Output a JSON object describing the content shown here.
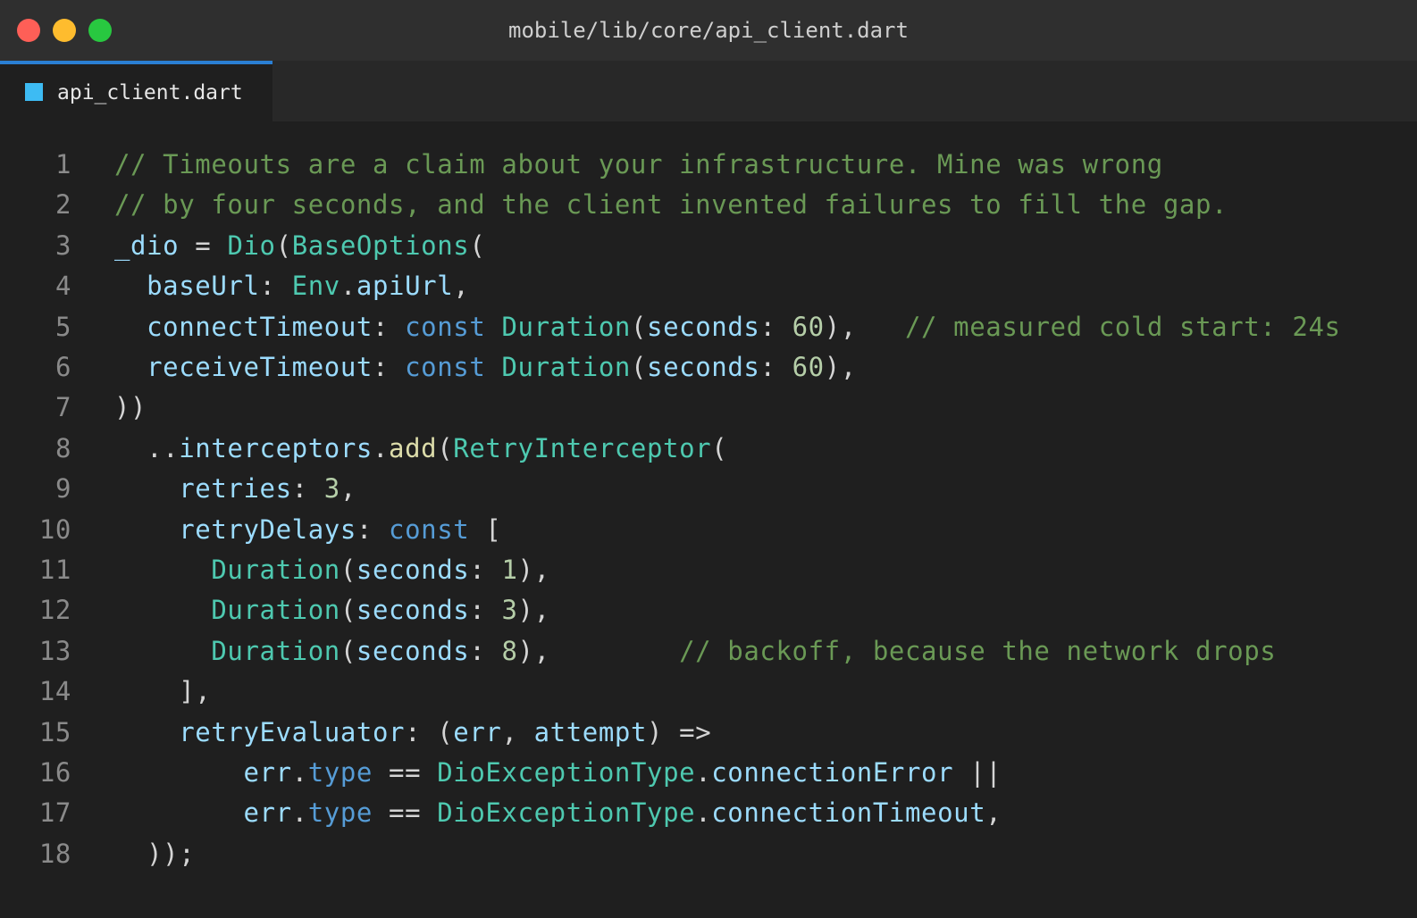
{
  "window": {
    "title": "mobile/lib/core/api_client.dart"
  },
  "tab": {
    "label": "api_client.dart",
    "icon": "dart-file-icon"
  },
  "colors": {
    "comment": "#6a9955",
    "type": "#4ec9b0",
    "property": "#9cdcfe",
    "keyword": "#569cd6",
    "number": "#b5cea8",
    "function": "#dcdcaa",
    "accent": "#2a7fd4"
  },
  "lines": [
    {
      "n": "1",
      "tokens": [
        {
          "t": "// Timeouts are a claim about your infrastructure. Mine was wrong",
          "k": "comment"
        }
      ]
    },
    {
      "n": "2",
      "tokens": [
        {
          "t": "// by four seconds, and the client invented failures to fill the gap.",
          "k": "comment"
        }
      ]
    },
    {
      "n": "3",
      "tokens": [
        {
          "t": "_dio",
          "k": "prop"
        },
        {
          "t": " = ",
          "k": "punc"
        },
        {
          "t": "Dio",
          "k": "type"
        },
        {
          "t": "(",
          "k": "punc"
        },
        {
          "t": "BaseOptions",
          "k": "type"
        },
        {
          "t": "(",
          "k": "punc"
        }
      ]
    },
    {
      "n": "4",
      "tokens": [
        {
          "t": "  ",
          "k": "punc"
        },
        {
          "t": "baseUrl",
          "k": "prop"
        },
        {
          "t": ": ",
          "k": "punc"
        },
        {
          "t": "Env",
          "k": "type"
        },
        {
          "t": ".",
          "k": "punc"
        },
        {
          "t": "apiUrl",
          "k": "prop"
        },
        {
          "t": ",",
          "k": "punc"
        }
      ]
    },
    {
      "n": "5",
      "tokens": [
        {
          "t": "  ",
          "k": "punc"
        },
        {
          "t": "connectTimeout",
          "k": "prop"
        },
        {
          "t": ": ",
          "k": "punc"
        },
        {
          "t": "const",
          "k": "kw"
        },
        {
          "t": " ",
          "k": "punc"
        },
        {
          "t": "Duration",
          "k": "type"
        },
        {
          "t": "(",
          "k": "punc"
        },
        {
          "t": "seconds",
          "k": "prop"
        },
        {
          "t": ": ",
          "k": "punc"
        },
        {
          "t": "60",
          "k": "num"
        },
        {
          "t": "),   ",
          "k": "punc"
        },
        {
          "t": "// measured cold start: 24s",
          "k": "comment"
        }
      ]
    },
    {
      "n": "6",
      "tokens": [
        {
          "t": "  ",
          "k": "punc"
        },
        {
          "t": "receiveTimeout",
          "k": "prop"
        },
        {
          "t": ": ",
          "k": "punc"
        },
        {
          "t": "const",
          "k": "kw"
        },
        {
          "t": " ",
          "k": "punc"
        },
        {
          "t": "Duration",
          "k": "type"
        },
        {
          "t": "(",
          "k": "punc"
        },
        {
          "t": "seconds",
          "k": "prop"
        },
        {
          "t": ": ",
          "k": "punc"
        },
        {
          "t": "60",
          "k": "num"
        },
        {
          "t": "),",
          "k": "punc"
        }
      ]
    },
    {
      "n": "7",
      "tokens": [
        {
          "t": "))",
          "k": "punc"
        }
      ]
    },
    {
      "n": "8",
      "tokens": [
        {
          "t": "  ..",
          "k": "punc"
        },
        {
          "t": "interceptors",
          "k": "prop"
        },
        {
          "t": ".",
          "k": "punc"
        },
        {
          "t": "add",
          "k": "fn"
        },
        {
          "t": "(",
          "k": "punc"
        },
        {
          "t": "RetryInterceptor",
          "k": "type"
        },
        {
          "t": "(",
          "k": "punc"
        }
      ]
    },
    {
      "n": "9",
      "tokens": [
        {
          "t": "    ",
          "k": "punc"
        },
        {
          "t": "retries",
          "k": "prop"
        },
        {
          "t": ": ",
          "k": "punc"
        },
        {
          "t": "3",
          "k": "num"
        },
        {
          "t": ",",
          "k": "punc"
        }
      ]
    },
    {
      "n": "10",
      "tokens": [
        {
          "t": "    ",
          "k": "punc"
        },
        {
          "t": "retryDelays",
          "k": "prop"
        },
        {
          "t": ": ",
          "k": "punc"
        },
        {
          "t": "const",
          "k": "kw"
        },
        {
          "t": " [",
          "k": "punc"
        }
      ]
    },
    {
      "n": "11",
      "tokens": [
        {
          "t": "      ",
          "k": "punc"
        },
        {
          "t": "Duration",
          "k": "type"
        },
        {
          "t": "(",
          "k": "punc"
        },
        {
          "t": "seconds",
          "k": "prop"
        },
        {
          "t": ": ",
          "k": "punc"
        },
        {
          "t": "1",
          "k": "num"
        },
        {
          "t": "),",
          "k": "punc"
        }
      ]
    },
    {
      "n": "12",
      "tokens": [
        {
          "t": "      ",
          "k": "punc"
        },
        {
          "t": "Duration",
          "k": "type"
        },
        {
          "t": "(",
          "k": "punc"
        },
        {
          "t": "seconds",
          "k": "prop"
        },
        {
          "t": ": ",
          "k": "punc"
        },
        {
          "t": "3",
          "k": "num"
        },
        {
          "t": "),",
          "k": "punc"
        }
      ]
    },
    {
      "n": "13",
      "tokens": [
        {
          "t": "      ",
          "k": "punc"
        },
        {
          "t": "Duration",
          "k": "type"
        },
        {
          "t": "(",
          "k": "punc"
        },
        {
          "t": "seconds",
          "k": "prop"
        },
        {
          "t": ": ",
          "k": "punc"
        },
        {
          "t": "8",
          "k": "num"
        },
        {
          "t": "),        ",
          "k": "punc"
        },
        {
          "t": "// backoff, because the network drops",
          "k": "comment"
        }
      ]
    },
    {
      "n": "14",
      "tokens": [
        {
          "t": "    ],",
          "k": "punc"
        }
      ]
    },
    {
      "n": "15",
      "tokens": [
        {
          "t": "    ",
          "k": "punc"
        },
        {
          "t": "retryEvaluator",
          "k": "prop"
        },
        {
          "t": ": (",
          "k": "punc"
        },
        {
          "t": "err",
          "k": "prop"
        },
        {
          "t": ", ",
          "k": "punc"
        },
        {
          "t": "attempt",
          "k": "prop"
        },
        {
          "t": ") =>",
          "k": "punc"
        }
      ]
    },
    {
      "n": "16",
      "tokens": [
        {
          "t": "        ",
          "k": "punc"
        },
        {
          "t": "err",
          "k": "prop"
        },
        {
          "t": ".",
          "k": "punc"
        },
        {
          "t": "type",
          "k": "kw"
        },
        {
          "t": " == ",
          "k": "punc"
        },
        {
          "t": "DioExceptionType",
          "k": "type"
        },
        {
          "t": ".",
          "k": "punc"
        },
        {
          "t": "connectionError",
          "k": "prop"
        },
        {
          "t": " ||",
          "k": "punc"
        }
      ]
    },
    {
      "n": "17",
      "tokens": [
        {
          "t": "        ",
          "k": "punc"
        },
        {
          "t": "err",
          "k": "prop"
        },
        {
          "t": ".",
          "k": "punc"
        },
        {
          "t": "type",
          "k": "kw"
        },
        {
          "t": " == ",
          "k": "punc"
        },
        {
          "t": "DioExceptionType",
          "k": "type"
        },
        {
          "t": ".",
          "k": "punc"
        },
        {
          "t": "connectionTimeout",
          "k": "prop"
        },
        {
          "t": ",",
          "k": "punc"
        }
      ]
    },
    {
      "n": "18",
      "tokens": [
        {
          "t": "  ));",
          "k": "punc"
        }
      ]
    }
  ]
}
